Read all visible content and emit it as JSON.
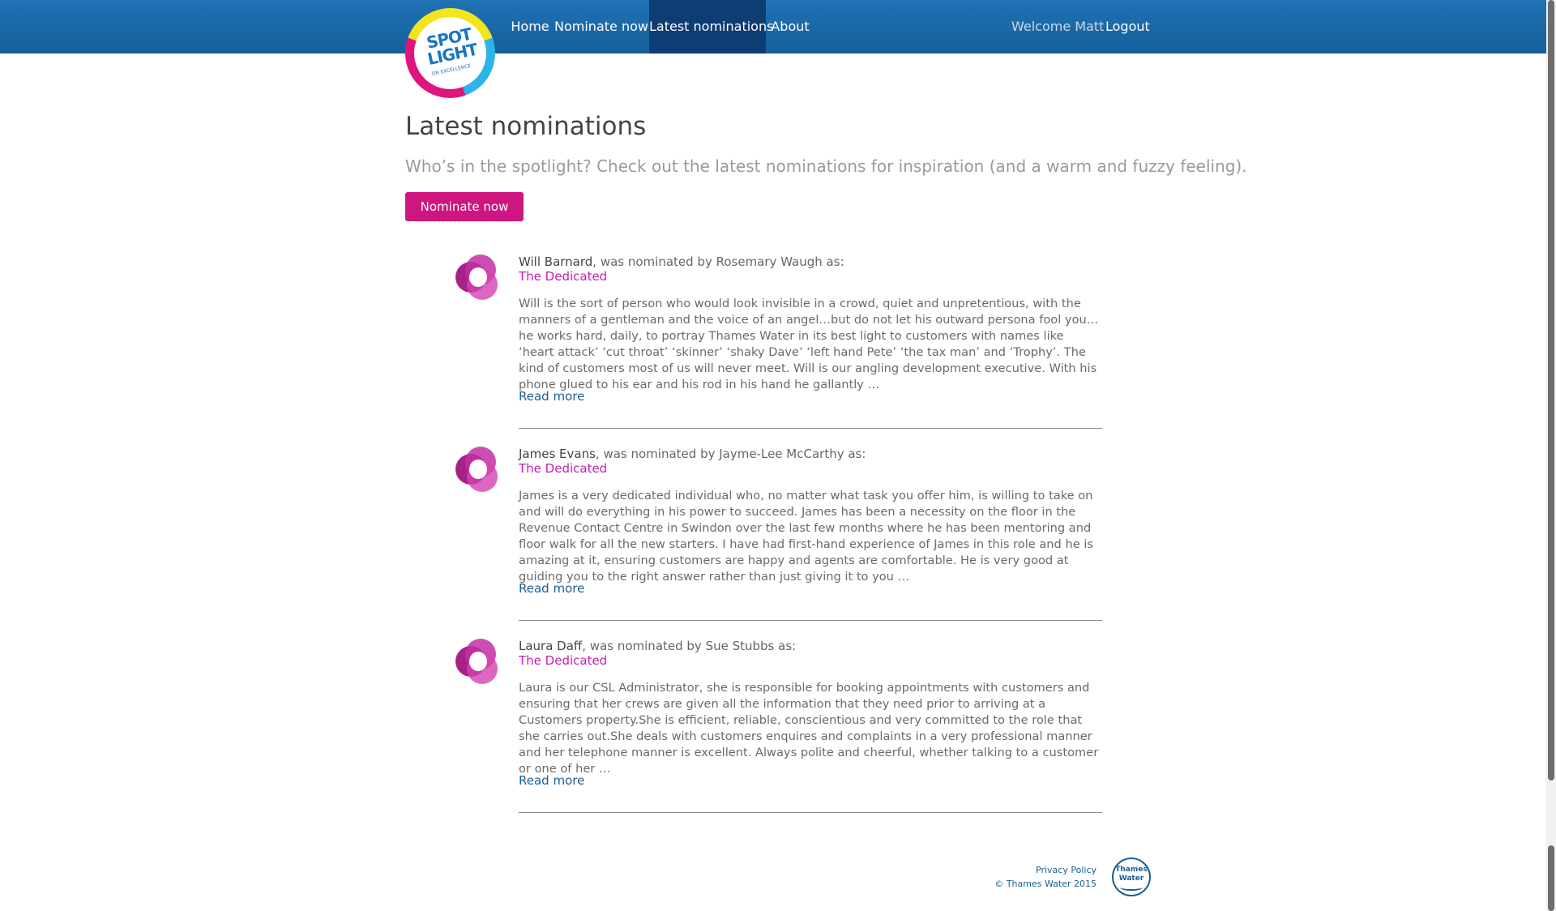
{
  "nav": {
    "items": [
      {
        "label": "Home"
      },
      {
        "label": "Nominate now"
      },
      {
        "label": "Latest nominations",
        "active": true
      },
      {
        "label": "About"
      }
    ],
    "welcome": "Welcome Matt",
    "logout": "Logout"
  },
  "logo": {
    "line1": "SPOT",
    "line2": "LIGHT",
    "tagline": "ON EXCELLENCE"
  },
  "page": {
    "title": "Latest nominations",
    "lead": "Who’s in the spotlight? Check out the latest nominations for inspiration (and a warm and fuzzy feeling).",
    "cta": "Nominate now"
  },
  "nominations": [
    {
      "nominee": "Will Barnard",
      "by_text": ", was nominated by Rosemary Waugh as:",
      "category": "The Dedicated",
      "text": "Will is the sort of person who would look invisible in a crowd, quiet and unpretentious, with the manners of a gentleman and the voice of an angel…but do not let his outward persona fool you… he works hard, daily, to portray Thames Water in its best light to customers with names like ‘heart attack’ ‘cut throat’ ‘skinner’ ‘shaky Dave’ ‘left hand Pete’ ‘the tax man’ and ‘Trophy’. The kind of customers most of us will never meet. Will is our angling development executive. With his phone glued to his ear and his rod in his hand he gallantly …",
      "read_more": "Read more"
    },
    {
      "nominee": "James Evans",
      "by_text": ", was nominated by Jayme-Lee McCarthy as:",
      "category": "The Dedicated",
      "text": "James is a very dedicated individual who, no matter what task you offer him, is willing to take on and will do everything in his power to succeed. James has been a necessity on the floor in the Revenue Contact Centre in Swindon over the last few months where he has been mentoring and floor walk for all the new starters. I have had first-hand experience of James in this role and he is amazing at it, ensuring customers are happy and agents are comfortable. He is very good at guiding you to the right answer rather than just giving it to you …",
      "read_more": "Read more"
    },
    {
      "nominee": "Laura Daff",
      "by_text": ", was nominated by Sue Stubbs as:",
      "category": "The Dedicated",
      "text": "Laura is our CSL Administrator, she is responsible for booking appointments with customers and ensuring that her crews are given all the information that they need prior to arriving at a Customers property.She is efficient, reliable, conscientious and very committed to the role that she carries out.She deals with customers enquires and complaints in a very professional manner and her telephone manner is excellent. Always polite and cheerful, whether talking to a customer or one of her …",
      "read_more": "Read more"
    }
  ],
  "footer": {
    "privacy": "Privacy Policy",
    "copyright": "© Thames Water 2015",
    "logo_line1": "Thames",
    "logo_line2": "Water"
  },
  "colors": {
    "topbar": "#1f72b4",
    "active_nav": "#0d3d72",
    "accent": "#cf157f",
    "category": "#c21fb2",
    "link": "#1a5f93"
  }
}
